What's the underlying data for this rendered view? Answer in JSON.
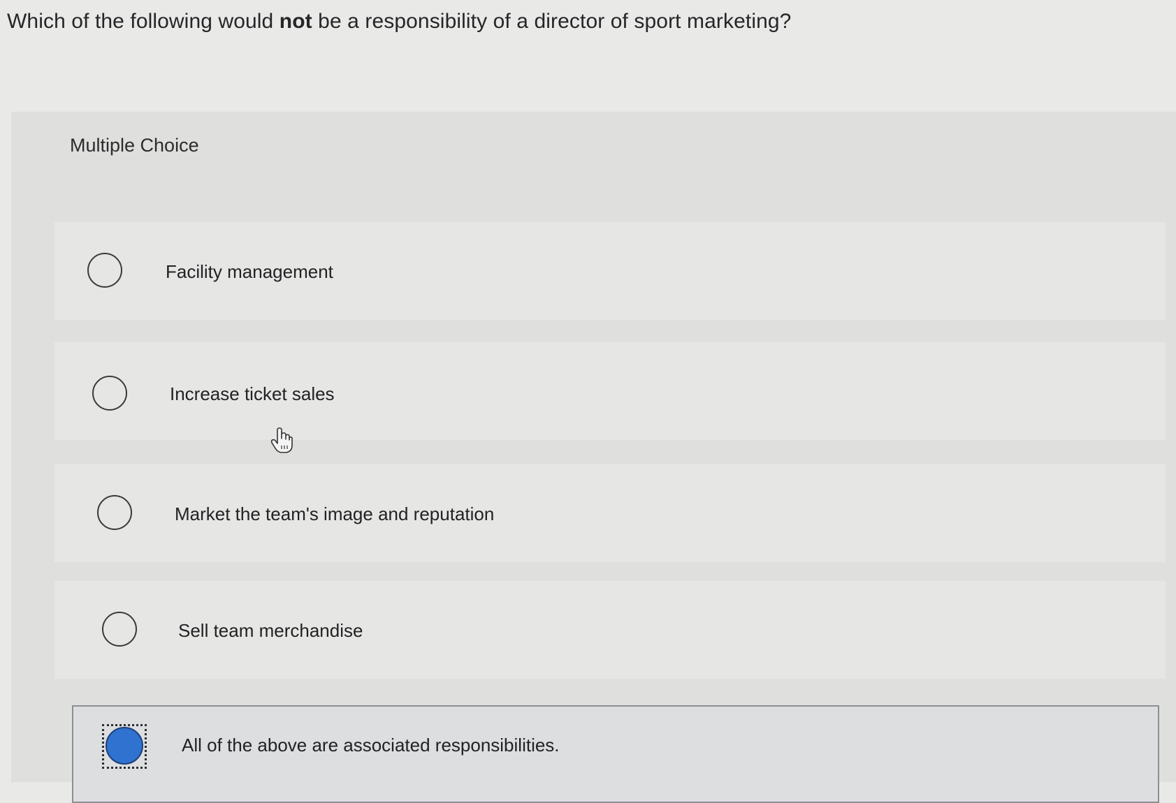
{
  "question": {
    "prefix": "Which of the following would ",
    "emphasis": "not",
    "suffix": " be a responsibility of a director of sport marketing?"
  },
  "section_label": "Multiple Choice",
  "options": [
    {
      "label": "Facility management",
      "selected": false
    },
    {
      "label": "Increase ticket sales",
      "selected": false
    },
    {
      "label": "Market the team's image and reputation",
      "selected": false
    },
    {
      "label": "Sell team merchandise",
      "selected": false
    },
    {
      "label": "All of the above are associated responsibilities.",
      "selected": true
    }
  ],
  "colors": {
    "selected_radio": "#2f72cf",
    "background": "#e9e9e7"
  },
  "icons": {
    "cursor": "hand-pointer-icon"
  }
}
